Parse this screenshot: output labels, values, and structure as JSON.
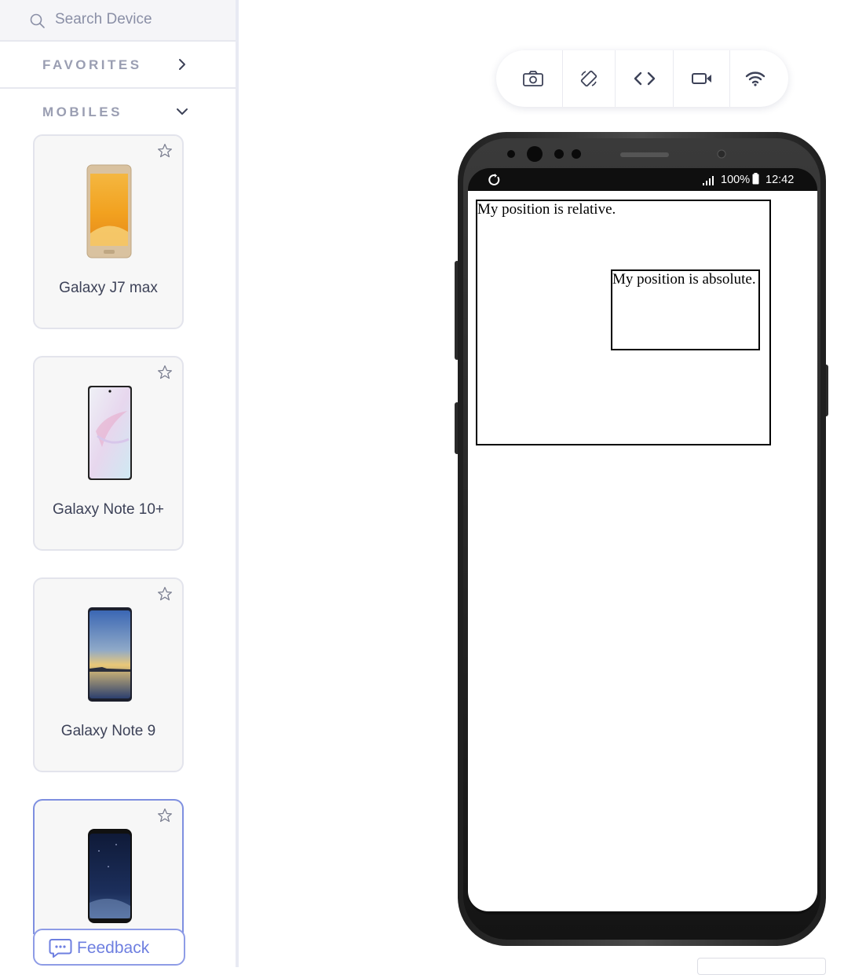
{
  "sidebar": {
    "search": {
      "placeholder": "Search Device",
      "icon": "search-icon"
    },
    "favorites": {
      "label": "FAVORITES",
      "icon": "chevron-right-icon"
    },
    "mobiles": {
      "label": "MOBILES",
      "icon": "chevron-down-icon"
    },
    "devices": [
      {
        "name": "Galaxy J7 max",
        "selected": false
      },
      {
        "name": "Galaxy Note 10+",
        "selected": false
      },
      {
        "name": "Galaxy Note 9",
        "selected": false
      },
      {
        "name": "",
        "selected": true
      }
    ],
    "feedback": {
      "label": "Feedback",
      "icon": "chat-icon"
    }
  },
  "toolbar": {
    "buttons": [
      {
        "name": "screenshot",
        "icon": "camera-icon"
      },
      {
        "name": "rotate",
        "icon": "rotate-icon"
      },
      {
        "name": "devtools",
        "icon": "code-icon"
      },
      {
        "name": "record",
        "icon": "video-icon"
      },
      {
        "name": "network",
        "icon": "wifi-icon"
      }
    ]
  },
  "phone": {
    "status_bar": {
      "battery": "100%",
      "time": "12:42"
    },
    "page": {
      "relative_text": "My position is relative.",
      "absolute_text": "My position is absolute."
    }
  },
  "colors": {
    "accent": "#6e7fe0",
    "muted_text": "#9a9eb2",
    "card_bg": "#f7f7f7"
  }
}
